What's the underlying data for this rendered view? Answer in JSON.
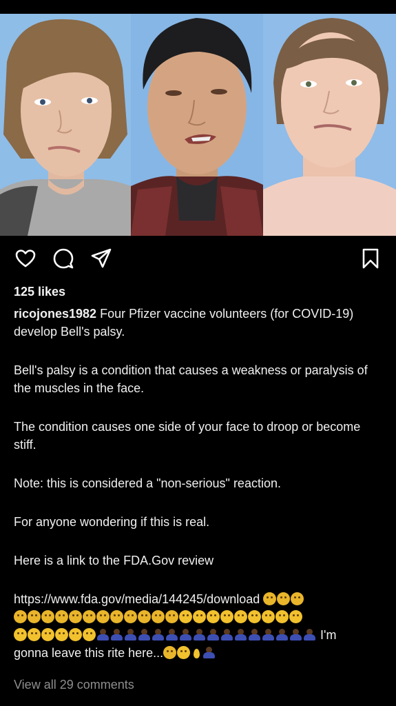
{
  "post": {
    "likes_text": "125 likes",
    "username": "ricojones1982",
    "caption_first": "Four Pfizer vaccine volunteers (for COVID-19) develop Bell's palsy.",
    "paragraph_1": "Bell's palsy is a condition that causes a weakness or paralysis of the muscles in the face.",
    "paragraph_2": "The condition causes one side of your face to droop or become stiff.",
    "paragraph_3": "Note: this is considered a \"non-serious\" reaction.",
    "paragraph_4": "For anyone wondering if this is real.",
    "paragraph_5": "Here is a link to the FDA.Gov review",
    "link_url": "https://www.fda.gov/media/144245/download",
    "closing_text_1": "I'm",
    "closing_text_2": "gonna leave this rite here...",
    "view_comments": "View all 29 comments"
  },
  "icons": [
    "heart-icon",
    "comment-icon",
    "share-icon",
    "bookmark-icon"
  ],
  "colors": {
    "background": "#000000",
    "text": "#f0f0f0",
    "muted": "#8e8e8e",
    "photo_backdrop": "#7fb3e6"
  }
}
